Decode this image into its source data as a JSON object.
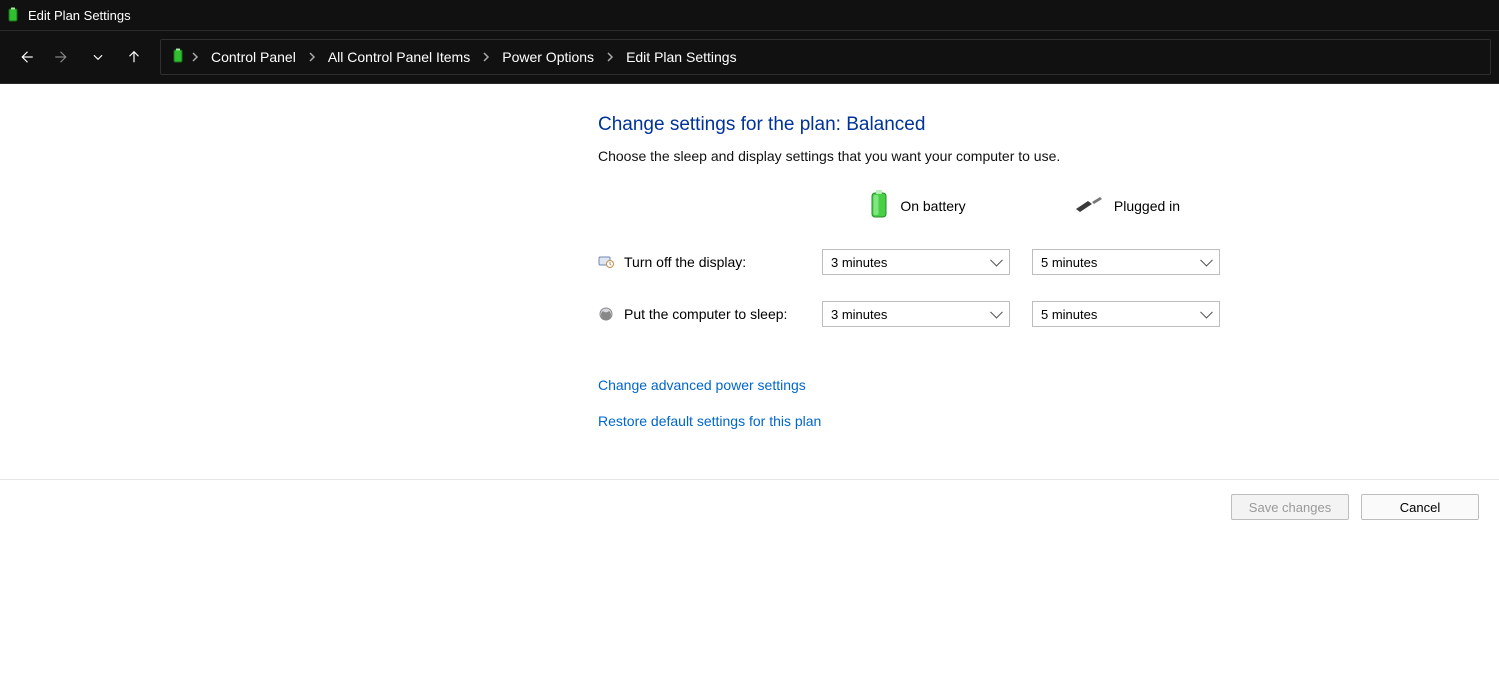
{
  "window": {
    "title": "Edit Plan Settings"
  },
  "breadcrumb": {
    "items": [
      {
        "label": "Control Panel"
      },
      {
        "label": "All Control Panel Items"
      },
      {
        "label": "Power Options"
      },
      {
        "label": "Edit Plan Settings"
      }
    ]
  },
  "main": {
    "heading": "Change settings for the plan: Balanced",
    "subtext": "Choose the sleep and display settings that you want your computer to use.",
    "columns": {
      "battery": "On battery",
      "plugged": "Plugged in"
    },
    "rows": {
      "display": {
        "label": "Turn off the display:",
        "battery_value": "3 minutes",
        "plugged_value": "5 minutes"
      },
      "sleep": {
        "label": "Put the computer to sleep:",
        "battery_value": "3 minutes",
        "plugged_value": "5 minutes"
      }
    },
    "links": {
      "advanced": "Change advanced power settings",
      "restore": "Restore default settings for this plan"
    }
  },
  "footer": {
    "save": "Save changes",
    "cancel": "Cancel"
  }
}
